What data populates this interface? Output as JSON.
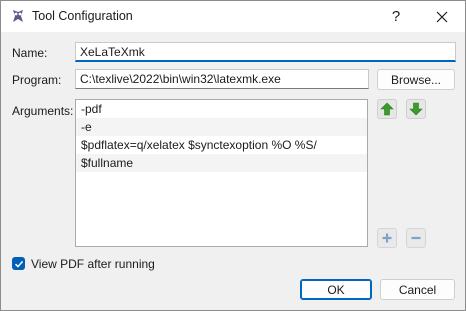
{
  "window": {
    "title": "Tool Configuration",
    "help_glyph": "?",
    "close_glyph": "✕"
  },
  "name": {
    "label": "Name:",
    "value": "XeLaTeXmk"
  },
  "program": {
    "label": "Program:",
    "value": "C:\\texlive\\2022\\bin\\win32\\latexmk.exe",
    "browse_label": "Browse..."
  },
  "arguments": {
    "label": "Arguments:",
    "items": [
      "-pdf",
      "-e",
      "$pdflatex=q/xelatex $synctexoption %O %S/",
      "$fullname"
    ],
    "move_up_icon": "arrow-up-icon",
    "move_down_icon": "arrow-down-icon",
    "add_icon": "plus-icon",
    "remove_icon": "minus-icon",
    "accent_color": "#3c9a2e"
  },
  "view_pdf": {
    "label": "View PDF after running",
    "checked": true
  },
  "buttons": {
    "ok_label": "OK",
    "cancel_label": "Cancel"
  },
  "colors": {
    "accent": "#005fb8",
    "focus": "#0067c0"
  }
}
